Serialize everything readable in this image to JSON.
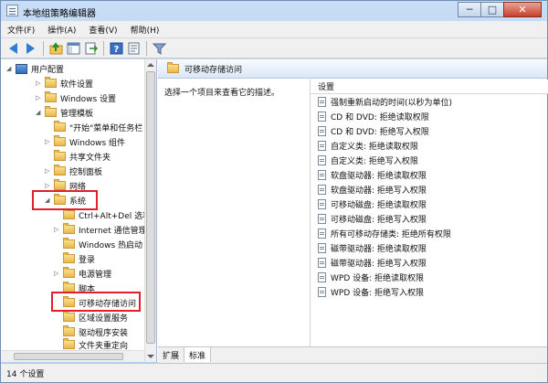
{
  "window": {
    "title": "本地组策略编辑器",
    "min": "─",
    "max": "□",
    "close": "✕"
  },
  "menu": [
    "文件(F)",
    "操作(A)",
    "查看(V)",
    "帮助(H)"
  ],
  "tree": {
    "items": [
      {
        "label": "用户配置",
        "exp": "◢"
      },
      {
        "label": "软件设置",
        "exp": "▷"
      },
      {
        "label": "Windows 设置",
        "exp": "▷"
      },
      {
        "label": "管理模板",
        "exp": "◢"
      },
      {
        "label": "\"开始\"菜单和任务栏",
        "exp": ""
      },
      {
        "label": "Windows 组件",
        "exp": "▷"
      },
      {
        "label": "共享文件夹",
        "exp": ""
      },
      {
        "label": "控制面板",
        "exp": "▷"
      },
      {
        "label": "网络",
        "exp": "▷"
      },
      {
        "label": "系统",
        "exp": "◢"
      },
      {
        "label": "Ctrl+Alt+Del 选项",
        "exp": ""
      },
      {
        "label": "Internet 通信管理",
        "exp": "▷"
      },
      {
        "label": "Windows 热启动",
        "exp": ""
      },
      {
        "label": "登录",
        "exp": ""
      },
      {
        "label": "电源管理",
        "exp": "▷"
      },
      {
        "label": "脚本",
        "exp": ""
      },
      {
        "label": "可移动存储访问",
        "exp": ""
      },
      {
        "label": "区域设置服务",
        "exp": ""
      },
      {
        "label": "驱动程序安装",
        "exp": ""
      },
      {
        "label": "文件夹重定向",
        "exp": ""
      }
    ]
  },
  "details": {
    "header": "可移动存储访问",
    "description": "选择一个项目来查看它的描述。",
    "column": "设置",
    "settings": [
      "强制重新启动的时间(以秒为单位)",
      "CD 和 DVD: 拒绝读取权限",
      "CD 和 DVD: 拒绝写入权限",
      "自定义类: 拒绝读取权限",
      "自定义类: 拒绝写入权限",
      "软盘驱动器: 拒绝读取权限",
      "软盘驱动器: 拒绝写入权限",
      "可移动磁盘: 拒绝读取权限",
      "可移动磁盘: 拒绝写入权限",
      "所有可移动存储类: 拒绝所有权限",
      "磁带驱动器: 拒绝读取权限",
      "磁带驱动器: 拒绝写入权限",
      "WPD 设备: 拒绝读取权限",
      "WPD 设备: 拒绝写入权限"
    ]
  },
  "tabs": [
    "扩展",
    "标准"
  ],
  "status": "14 个设置",
  "colors": {
    "highlight": "#e0202c",
    "accent": "#2f7bd6"
  }
}
